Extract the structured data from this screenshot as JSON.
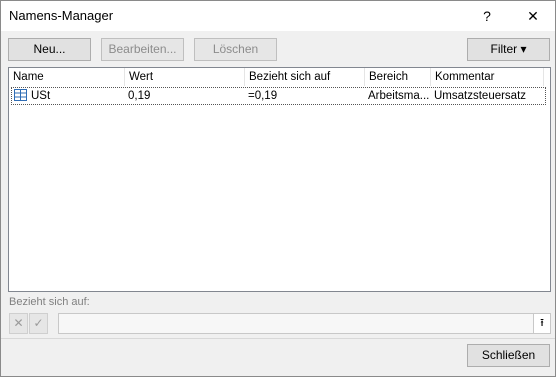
{
  "window": {
    "title": "Namens-Manager",
    "help_label": "?",
    "close_label": "✕"
  },
  "toolbar": {
    "new_label": "Neu...",
    "edit_label": "Bearbeiten...",
    "delete_label": "Löschen",
    "filter_label": "Filter ▾"
  },
  "table": {
    "columns": [
      "Name",
      "Wert",
      "Bezieht sich auf",
      "Bereich",
      "Kommentar"
    ],
    "rows": [
      {
        "name": "USt",
        "value": "0,19",
        "refers_to": "=0,19",
        "scope": "Arbeitsma...",
        "comment": "Umsatzsteuersatz"
      }
    ]
  },
  "refers_to": {
    "label": "Bezieht sich auf:",
    "value": "",
    "cancel_icon": "✕",
    "confirm_icon": "✓",
    "collapse_icon": "⭱"
  },
  "footer": {
    "close_label": "Schließen"
  }
}
